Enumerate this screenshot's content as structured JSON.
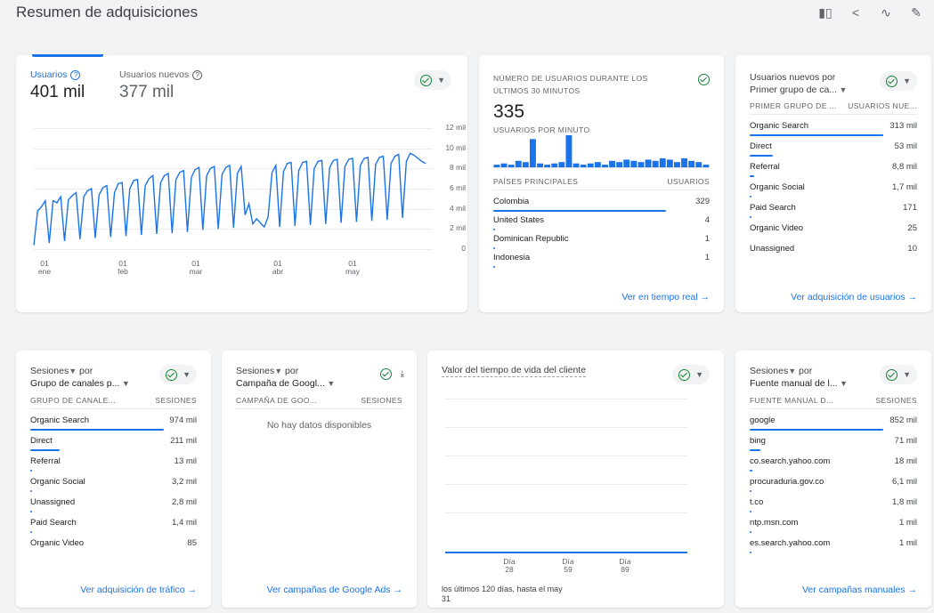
{
  "page": {
    "title": "Resumen de adquisiciones"
  },
  "top_actions": [
    "compare-icon",
    "share-icon",
    "insights-icon",
    "edit-icon"
  ],
  "main_chart": {
    "tabs": [
      {
        "label": "Usuarios",
        "value": "401 mil"
      },
      {
        "label": "Usuarios nuevos",
        "value": "377 mil"
      }
    ],
    "y_ticks": [
      "12 mil",
      "10 mil",
      "8 mil",
      "6 mil",
      "4 mil",
      "2 mil",
      "0"
    ],
    "x_ticks": [
      {
        "d": "01",
        "m": "ene"
      },
      {
        "d": "01",
        "m": "feb"
      },
      {
        "d": "01",
        "m": "mar"
      },
      {
        "d": "01",
        "m": "abr"
      },
      {
        "d": "01",
        "m": "may"
      }
    ]
  },
  "chart_data": {
    "type": "line",
    "title": "",
    "xlabel": "",
    "ylabel": "",
    "ylim": [
      0,
      12000
    ],
    "x_ticks": [
      "01 ene",
      "01 feb",
      "01 mar",
      "01 abr",
      "01 may"
    ],
    "series": [
      {
        "values": [
          400,
          3800,
          4200,
          4800,
          600,
          4800,
          4600,
          5200,
          800,
          4900,
          5300,
          5600,
          1000,
          5200,
          5800,
          6000,
          1100,
          5400,
          6100,
          6300,
          1200,
          5600,
          6500,
          6600,
          1300,
          6000,
          6800,
          6900,
          1400,
          6300,
          7000,
          7300,
          1500,
          6600,
          7300,
          7500,
          1600,
          6900,
          7600,
          7800,
          1700,
          7100,
          7900,
          8100,
          1900,
          7300,
          8000,
          8200,
          2000,
          7400,
          8100,
          8300,
          2100,
          7500,
          8200,
          3400,
          4500,
          2500,
          3000,
          2600,
          2200,
          3200,
          7600,
          8300,
          2200,
          7700,
          8500,
          8600,
          2300,
          7800,
          8600,
          8700,
          2400,
          8000,
          8700,
          8800,
          2500,
          8100,
          8800,
          8900,
          2600,
          8200,
          8900,
          9000,
          2700,
          8300,
          9000,
          9100,
          2800,
          8400,
          9100,
          9200,
          2900,
          8500,
          9200,
          9400,
          3100,
          8700,
          9500,
          9300,
          9000,
          8700,
          8500
        ]
      }
    ]
  },
  "realtime": {
    "heading": "NÚMERO DE USUARIOS DURANTE LOS ÚLTIMOS 30 MINUTOS",
    "value": "335",
    "sub": "USUARIOS POR MINUTO",
    "bars": [
      2,
      3,
      2,
      5,
      4,
      22,
      3,
      2,
      3,
      4,
      25,
      3,
      2,
      3,
      4,
      2,
      5,
      4,
      6,
      5,
      4,
      6,
      5,
      7,
      6,
      4,
      7,
      5,
      4,
      2
    ],
    "col_left": "PAÍSES PRINCIPALES",
    "col_right": "USUARIOS",
    "rows": [
      {
        "label": "Colombia",
        "value": "329",
        "pct": 1.0
      },
      {
        "label": "United States",
        "value": "4",
        "pct": 0.012
      },
      {
        "label": "Dominican Republic",
        "value": "1",
        "pct": 0.003
      },
      {
        "label": "Indonesia",
        "value": "1",
        "pct": 0.003
      }
    ],
    "link": "Ver en tiempo real"
  },
  "new_users": {
    "heading1": "Usuarios nuevos por",
    "heading2": "Primer grupo de ca...",
    "col_left": "PRIMER GRUPO DE ...",
    "col_right": "USUARIOS NUE...",
    "rows": [
      {
        "label": "Organic Search",
        "value": "313 mil",
        "pct": 1.0
      },
      {
        "label": "Direct",
        "value": "53 mil",
        "pct": 0.17
      },
      {
        "label": "Referral",
        "value": "8,8 mil",
        "pct": 0.03
      },
      {
        "label": "Organic Social",
        "value": "1,7 mil",
        "pct": 0.006
      },
      {
        "label": "Paid Search",
        "value": "171",
        "pct": 0.001
      },
      {
        "label": "Organic Video",
        "value": "25",
        "pct": 0.0
      },
      {
        "label": "Unassigned",
        "value": "10",
        "pct": 0.0
      }
    ],
    "link": "Ver adquisición de usuarios"
  },
  "sessions_channel": {
    "heading1": "Sesiones",
    "heading1b": " por",
    "heading2": "Grupo de canales p...",
    "col_left": "GRUPO DE CANALE...",
    "col_right": "SESIONES",
    "rows": [
      {
        "label": "Organic Search",
        "value": "974 mil",
        "pct": 1.0
      },
      {
        "label": "Direct",
        "value": "211 mil",
        "pct": 0.22
      },
      {
        "label": "Referral",
        "value": "13 mil",
        "pct": 0.013
      },
      {
        "label": "Organic Social",
        "value": "3,2 mil",
        "pct": 0.004
      },
      {
        "label": "Unassigned",
        "value": "2,8 mil",
        "pct": 0.003
      },
      {
        "label": "Paid Search",
        "value": "1,4 mil",
        "pct": 0.002
      },
      {
        "label": "Organic Video",
        "value": "85",
        "pct": 0.0
      }
    ],
    "link": "Ver adquisición de tráfico"
  },
  "sessions_campaign": {
    "heading1": "Sesiones",
    "heading1b": " por",
    "heading2": "Campaña de Googl...",
    "col_left": "CAMPAÑA DE GOO...",
    "col_right": "SESIONES",
    "empty": "No hay datos disponibles",
    "link": "Ver campañas de Google Ads"
  },
  "ltv": {
    "heading": "Valor del tiempo de vida del cliente",
    "x_ticks": [
      {
        "a": "Día",
        "b": "28"
      },
      {
        "a": "Día",
        "b": "59"
      },
      {
        "a": "Día",
        "b": "89"
      }
    ],
    "footer": "los últimos 120 días, hasta el may 31"
  },
  "sessions_manual": {
    "heading1": "Sesiones",
    "heading1b": " por",
    "heading2": "Fuente manual de l...",
    "col_left": "FUENTE MANUAL D...",
    "col_right": "SESIONES",
    "rows": [
      {
        "label": "google",
        "value": "852 mil",
        "pct": 1.0
      },
      {
        "label": "bing",
        "value": "71 mil",
        "pct": 0.08
      },
      {
        "label": "co.search.yahoo.com",
        "value": "18 mil",
        "pct": 0.02
      },
      {
        "label": "procuraduria.gov.co",
        "value": "6,1 mil",
        "pct": 0.007
      },
      {
        "label": "t.co",
        "value": "1,8 mil",
        "pct": 0.002
      },
      {
        "label": "ntp.msn.com",
        "value": "1 mil",
        "pct": 0.001
      },
      {
        "label": "es.search.yahoo.com",
        "value": "1 mil",
        "pct": 0.001
      }
    ],
    "link": "Ver campañas manuales"
  },
  "colors": {
    "accent": "#1a73e8",
    "success": "#188038"
  }
}
